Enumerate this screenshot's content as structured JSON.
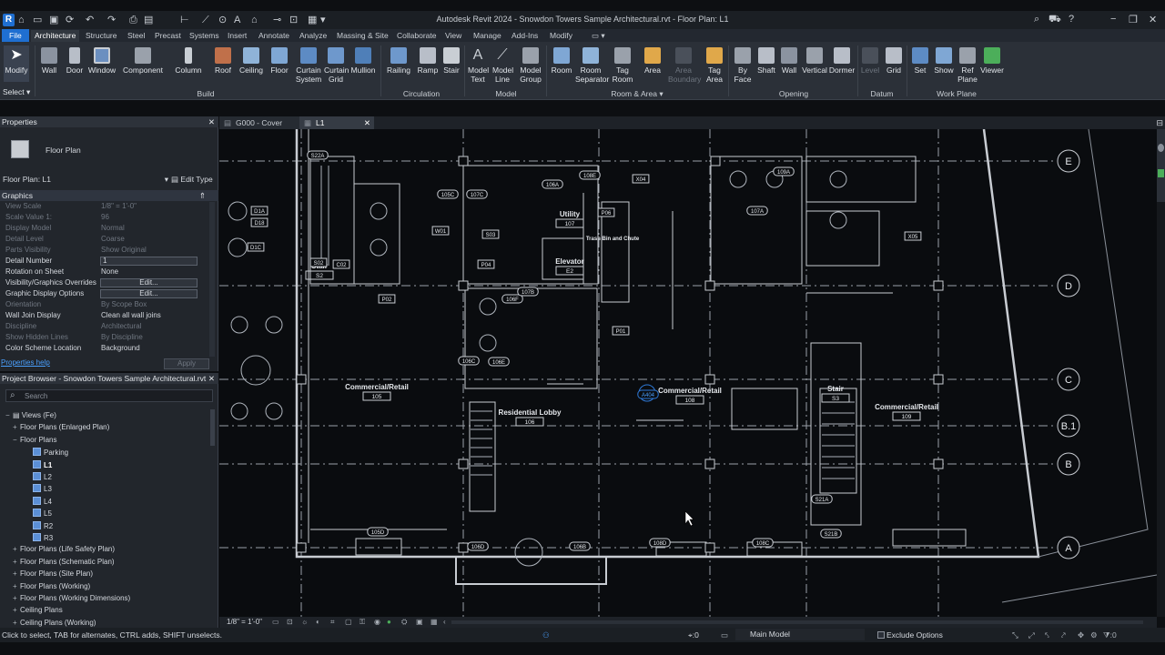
{
  "app": {
    "title": "Autodesk Revit 2024 - Snowdon Towers Sample Architectural.rvt - Floor Plan: L1",
    "logo": "R"
  },
  "qat_icons": [
    "open-icon",
    "save-icon",
    "undo-icon",
    "redo-icon",
    "print-icon",
    "measure-icon",
    "text-icon",
    "3d-view-icon",
    "section-icon",
    "switch-windows-icon"
  ],
  "tabs": [
    "File",
    "Architecture",
    "Structure",
    "Steel",
    "Precast",
    "Systems",
    "Insert",
    "Annotate",
    "Analyze",
    "Massing & Site",
    "Collaborate",
    "View",
    "Manage",
    "Add-Ins",
    "Modify"
  ],
  "active_tab": "Architecture",
  "ribbon": {
    "modify": "Modify",
    "select": "Select",
    "build": [
      "Wall",
      "Door",
      "Window",
      "Component",
      "Column",
      "Roof",
      "Ceiling",
      "Floor",
      "Curtain System",
      "Curtain Grid",
      "Mullion"
    ],
    "circulation": [
      "Railing",
      "Ramp",
      "Stair"
    ],
    "model": [
      "Model Text",
      "Model Line",
      "Model Group"
    ],
    "room": [
      "Room",
      "Room Separator",
      "Tag Room",
      "Area",
      "Area Boundary",
      "Tag Area"
    ],
    "opening": [
      "By Face",
      "Shaft",
      "Wall",
      "Vertical",
      "Dormer"
    ],
    "datum": [
      "Level",
      "Grid"
    ],
    "workplane": [
      "Set",
      "Show",
      "Ref Plane",
      "Viewer"
    ],
    "panels": [
      "Build",
      "Circulation",
      "Model",
      "Room & Area",
      "Opening",
      "Datum",
      "Work Plane"
    ]
  },
  "properties": {
    "header": "Properties",
    "type_name": "Floor Plan",
    "selector": "Floor Plan: L1",
    "edit_type": "Edit Type",
    "group": "Graphics",
    "rows": [
      {
        "label": "View Scale",
        "value": "1/8\" = 1'-0\""
      },
      {
        "label": "Scale Value    1:",
        "value": "96"
      },
      {
        "label": "Display Model",
        "value": "Normal"
      },
      {
        "label": "Detail Level",
        "value": "Coarse"
      },
      {
        "label": "Parts Visibility",
        "value": "Show Original"
      },
      {
        "label": "Detail Number",
        "value": "1"
      },
      {
        "label": "Rotation on Sheet",
        "value": "None"
      },
      {
        "label": "Visibility/Graphics Overrides",
        "value": "Edit..."
      },
      {
        "label": "Graphic Display Options",
        "value": "Edit..."
      },
      {
        "label": "Orientation",
        "value": "By Scope Box"
      },
      {
        "label": "Wall Join Display",
        "value": "Clean all wall joins"
      },
      {
        "label": "Discipline",
        "value": "Architectural"
      },
      {
        "label": "Show Hidden Lines",
        "value": "By Discipline"
      },
      {
        "label": "Color Scheme Location",
        "value": "Background"
      }
    ],
    "help": "Properties help",
    "apply": "Apply"
  },
  "browser": {
    "header": "Project Browser - Snowdon Towers Sample Architectural.rvt",
    "search_placeholder": "Search",
    "items": [
      {
        "label": "Views (Fe)",
        "level": 0,
        "toggle": "−"
      },
      {
        "label": "Floor Plans (Enlarged Plan)",
        "level": 1,
        "toggle": "+"
      },
      {
        "label": "Floor Plans",
        "level": 1,
        "toggle": "−"
      },
      {
        "label": "Parking",
        "level": 2,
        "toggle": ""
      },
      {
        "label": "L1",
        "level": 2,
        "toggle": ""
      },
      {
        "label": "L2",
        "level": 2,
        "toggle": ""
      },
      {
        "label": "L3",
        "level": 2,
        "toggle": ""
      },
      {
        "label": "L4",
        "level": 2,
        "toggle": ""
      },
      {
        "label": "L5",
        "level": 2,
        "toggle": ""
      },
      {
        "label": "R2",
        "level": 2,
        "toggle": ""
      },
      {
        "label": "R3",
        "level": 2,
        "toggle": ""
      },
      {
        "label": "Floor Plans (Life Safety Plan)",
        "level": 1,
        "toggle": "+"
      },
      {
        "label": "Floor Plans (Schematic Plan)",
        "level": 1,
        "toggle": "+"
      },
      {
        "label": "Floor Plans (Site Plan)",
        "level": 1,
        "toggle": "+"
      },
      {
        "label": "Floor Plans (Working)",
        "level": 1,
        "toggle": "+"
      },
      {
        "label": "Floor Plans (Working Dimensions)",
        "level": 1,
        "toggle": "+"
      },
      {
        "label": "Ceiling Plans",
        "level": 1,
        "toggle": "+"
      },
      {
        "label": "Ceiling Plans (Working)",
        "level": 1,
        "toggle": "+"
      }
    ]
  },
  "doc_tabs": [
    "G000 - Cover",
    "L1"
  ],
  "plan": {
    "grids": [
      "E",
      "D",
      "C",
      "B.1",
      "B",
      "A"
    ],
    "rooms": [
      {
        "name": "Commercial/Retail",
        "num": "105"
      },
      {
        "name": "Residential Lobby",
        "num": "106"
      },
      {
        "name": "Commercial/Retail",
        "num": "108"
      },
      {
        "name": "Commercial/Retail",
        "num": "109"
      },
      {
        "name": "Utility",
        "num": "107"
      },
      {
        "name": "Elevator",
        "num": "E2"
      },
      {
        "name": "Stair",
        "num": "S2"
      },
      {
        "name": "Stair",
        "num": "S3"
      },
      {
        "name": "Trash Bin and Chute",
        "num": ""
      }
    ],
    "tags": [
      "S22A",
      "S02",
      "P02",
      "W01",
      "C02",
      "107A",
      "108E",
      "107C",
      "105C",
      "X04",
      "P06",
      "X05",
      "D18",
      "D1C",
      "S03",
      "P04",
      "106F",
      "107B",
      "106A",
      "106E",
      "106C",
      "105D",
      "106D",
      "106B",
      "108D",
      "108C",
      "109A",
      "S21A",
      "S21B",
      "P01",
      "A404",
      "D1A"
    ]
  },
  "viewbar": {
    "scale": "1/8\" = 1'-0\""
  },
  "status": {
    "hint": "Click to select, TAB for alternates, CTRL adds, SHIFT unselects.",
    "model": "Main Model",
    "exclude": "Exclude Options",
    "count": ":0",
    "filter": ":0"
  }
}
